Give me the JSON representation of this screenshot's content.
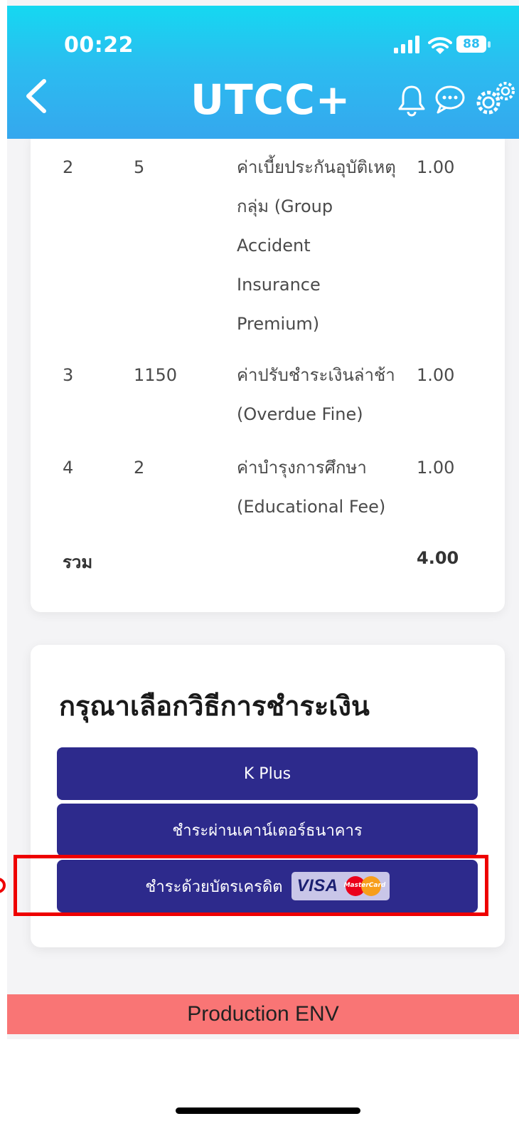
{
  "status_bar": {
    "time": "00:22",
    "battery": "88"
  },
  "header": {
    "title": "UTCC+"
  },
  "fee_items": [
    {
      "no": "2",
      "code": "5",
      "description": "ค่าเบี้ยประกันอุบัติเหตุ\nกลุ่ม (Group\nAccident\nInsurance\nPremium)",
      "amount": "1.00"
    },
    {
      "no": "3",
      "code": "1150",
      "description": "ค่าปรับชำระเงินล่าช้า\n(Overdue Fine)",
      "amount": "1.00"
    },
    {
      "no": "4",
      "code": "2",
      "description": "ค่าบำรุงการศึกษา\n(Educational Fee)",
      "amount": "1.00"
    }
  ],
  "total": {
    "label": "รวม",
    "amount": "4.00"
  },
  "payment": {
    "title": "กรุณาเลือกวิธีการชำระเงิน",
    "kplus_label": "K Plus",
    "counter_label": "ชำระผ่านเคาน์เตอร์ธนาคาร",
    "credit_label": "ชำระด้วยบัตรเครดิต",
    "visa_text": "VISA",
    "mastercard_text": "MasterCard"
  },
  "env_banner": "Production ENV",
  "colors": {
    "header_gradient_top": "#15d8f1",
    "header_gradient_bottom": "#35a7ee",
    "button_bg": "#2d2a8c",
    "highlight": "#ee0000",
    "env_banner": "#f97575"
  }
}
